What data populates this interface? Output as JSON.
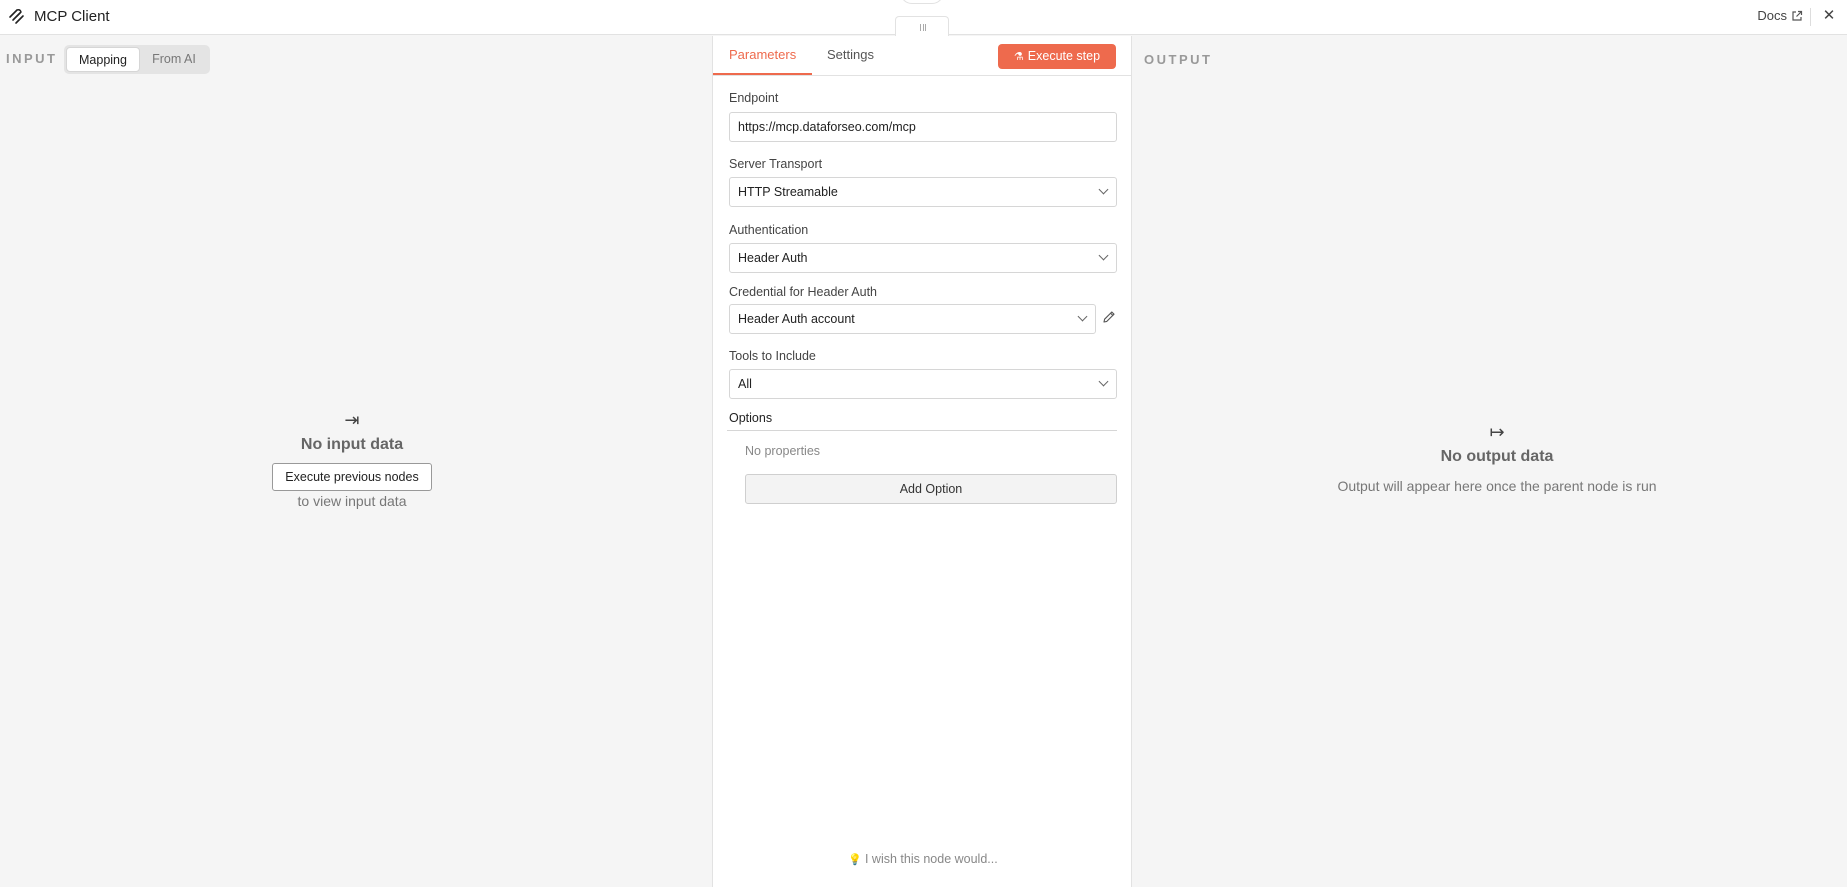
{
  "header": {
    "title": "MCP Client",
    "docs_label": "Docs"
  },
  "input": {
    "label": "INPUT",
    "modes": [
      "Mapping",
      "From AI"
    ],
    "empty_title": "No input data",
    "execute_previous_label": "Execute previous nodes",
    "empty_sub": "to view input data"
  },
  "params": {
    "tabs": [
      "Parameters",
      "Settings"
    ],
    "execute_step_label": "Execute step",
    "endpoint": {
      "label": "Endpoint",
      "value": "https://mcp.dataforseo.com/mcp"
    },
    "server_transport": {
      "label": "Server Transport",
      "value": "HTTP Streamable"
    },
    "authentication": {
      "label": "Authentication",
      "value": "Header Auth"
    },
    "credential": {
      "label": "Credential for Header Auth",
      "value": "Header Auth account"
    },
    "tools": {
      "label": "Tools to Include",
      "value": "All"
    },
    "options_label": "Options",
    "no_properties": "No properties",
    "add_option_label": "Add Option",
    "wish_label": "I wish this node would..."
  },
  "output": {
    "label": "OUTPUT",
    "empty_title": "No output data",
    "empty_sub": "Output will appear here once the parent node is run"
  },
  "colors": {
    "accent": "#ee6a4d"
  },
  "icons": {
    "logo": "mcp-logo-icon",
    "docs": "external-link-icon",
    "close": "close-icon",
    "input_empty": "arrow-to-right-bar-icon",
    "output_empty": "arrow-from-bar-icon",
    "execute": "flask-icon",
    "edit": "pencil-icon",
    "wish": "lightbulb-icon"
  }
}
